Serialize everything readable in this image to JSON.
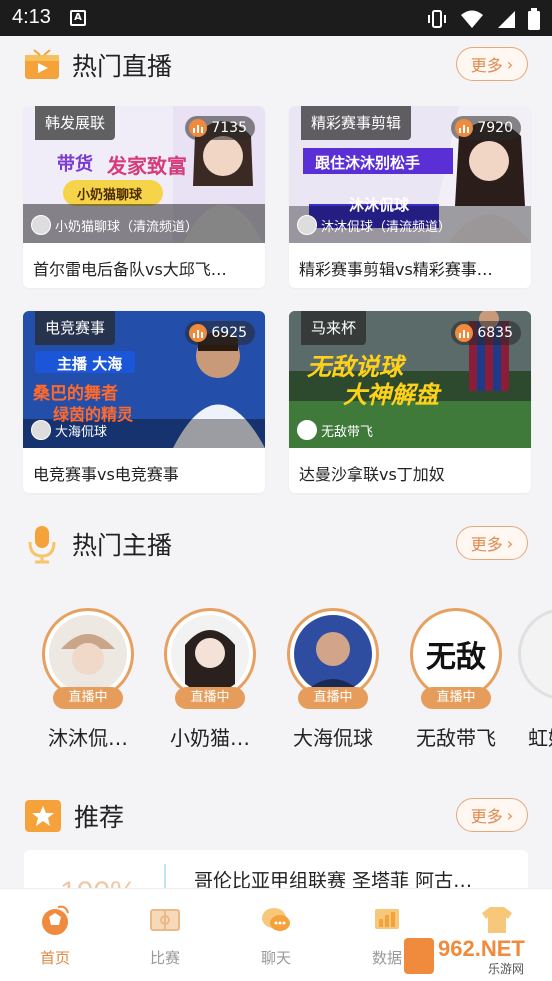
{
  "status": {
    "time": "4:13"
  },
  "hot_live": {
    "title": "热门直播",
    "more": "更多",
    "cards": [
      {
        "tag": "韩发展联",
        "viewers": "7135",
        "anchor": "小奶猫聊球（清流频道）",
        "title": "首尔雷电后备队vs大邱飞…",
        "thumb_text": [
          "带货",
          "发家致富",
          "小奶猫聊球"
        ]
      },
      {
        "tag": "精彩赛事剪辑",
        "viewers": "7920",
        "anchor": "沐沐侃球（清流频道）",
        "title": "精彩赛事剪辑vs精彩赛事…",
        "thumb_text": [
          "跟住沐沐别松手",
          "沐沐侃球"
        ]
      },
      {
        "tag": "电竞赛事",
        "viewers": "6925",
        "anchor": "大海侃球",
        "title": "电竞赛事vs电竞赛事",
        "thumb_text": [
          "主播 大海",
          "桑巴的舞者",
          "绿茵的精灵"
        ]
      },
      {
        "tag": "马来杯",
        "viewers": "6835",
        "anchor": "无敌带飞",
        "title": "达曼沙拿联vs丁加奴",
        "thumb_text": [
          "无敌说球",
          "大神解盘"
        ]
      }
    ]
  },
  "hot_anchors": {
    "title": "热门主播",
    "more": "更多",
    "items": [
      {
        "name": "沐沐侃…",
        "badge": "直播中"
      },
      {
        "name": "小奶猫…",
        "badge": "直播中"
      },
      {
        "name": "大海侃球",
        "badge": "直播中"
      },
      {
        "name": "无敌带飞",
        "badge": "直播中",
        "avatar_text": "无敌"
      },
      {
        "name": "虹妹",
        "badge": ""
      }
    ]
  },
  "recommend": {
    "title": "推荐",
    "more": "更多",
    "card": {
      "percent": "100%",
      "title": "哥伦比亚甲组联赛 圣塔菲 阿古…"
    }
  },
  "tabs": [
    {
      "label": "首页",
      "icon": "home-icon",
      "active": true
    },
    {
      "label": "比赛",
      "icon": "match-icon",
      "active": false
    },
    {
      "label": "聊天",
      "icon": "chat-icon",
      "active": false
    },
    {
      "label": "数据",
      "icon": "data-icon",
      "active": false
    },
    {
      "label": "",
      "icon": "jersey-icon",
      "active": false
    }
  ],
  "watermark": {
    "text": "962.NET",
    "sub": "乐游网"
  },
  "colors": {
    "accent": "#e0873d",
    "badge": "#e69d5b",
    "more_border": "#e6a77a"
  }
}
